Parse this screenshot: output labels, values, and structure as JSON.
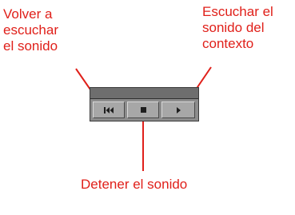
{
  "annotations": {
    "replay": [
      "Volver a",
      "escuchar",
      "el sonido"
    ],
    "context": [
      "Escuchar el",
      "sonido del",
      "contexto"
    ],
    "stop": "Detener el sonido"
  },
  "player": {
    "buttons": [
      {
        "name": "rewind-to-start",
        "icon": "skip-back-icon"
      },
      {
        "name": "stop",
        "icon": "stop-icon"
      },
      {
        "name": "play",
        "icon": "play-icon"
      }
    ]
  },
  "colors": {
    "annotation": "#e0201a",
    "player_body": "#8c8c8c",
    "button_face": "#a7a7a7"
  }
}
